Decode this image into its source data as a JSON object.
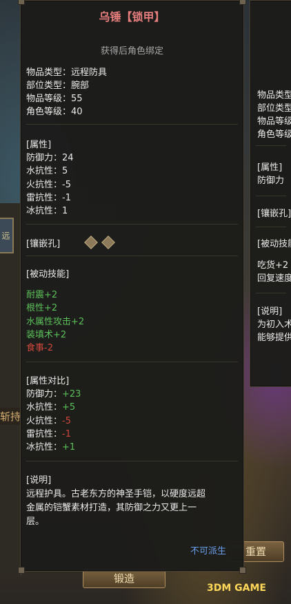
{
  "main": {
    "title": "乌锤【锁甲】",
    "bind_text": "获得后角色绑定",
    "basic": [
      {
        "label": "物品类型：",
        "value": "远程防具"
      },
      {
        "label": "部位类型：",
        "value": "腕部"
      },
      {
        "label": "物品等级：",
        "value": "55"
      },
      {
        "label": "角色等级：",
        "value": "40"
      }
    ],
    "attr_header": "[属性]",
    "attrs": [
      {
        "label": "防御力：",
        "value": "24"
      },
      {
        "label": "水抗性：",
        "value": "5"
      },
      {
        "label": "火抗性：",
        "value": "-5"
      },
      {
        "label": "雷抗性：",
        "value": "-1"
      },
      {
        "label": "冰抗性：",
        "value": "1"
      }
    ],
    "socket_header": "[镶嵌孔]",
    "skill_header": "[被动技能]",
    "skills": [
      {
        "text": "耐震+2",
        "color": "#5cc05a"
      },
      {
        "text": "根性+2",
        "color": "#5cc05a"
      },
      {
        "text": "水属性攻击+2",
        "color": "#5cc05a"
      },
      {
        "text": "装填术+2",
        "color": "#5cc05a"
      },
      {
        "text": "食事-2",
        "color": "#d0483c"
      }
    ],
    "compare_header": "[属性对比]",
    "compare": [
      {
        "label": "防御力：",
        "value": "+23",
        "color": "#5cc05a"
      },
      {
        "label": "水抗性：",
        "value": "+5",
        "color": "#5cc05a"
      },
      {
        "label": "火抗性：",
        "value": "-5",
        "color": "#d0483c"
      },
      {
        "label": "雷抗性：",
        "value": "-1",
        "color": "#d0483c"
      },
      {
        "label": "冰抗性：",
        "value": "+1",
        "color": "#5cc05a"
      }
    ],
    "desc_header": "[说明]",
    "desc_lines": [
      "远程护具。古老东方的神圣手铠，以硬度远超",
      "金属的铠蟹素材打造，其防御之力又更上一",
      "层。"
    ],
    "derive": "不可派生"
  },
  "side": {
    "basic": [
      "物品类型",
      "部位类型",
      "物品等级",
      "角色等级"
    ],
    "attr_header": "[属性]",
    "attr_line": "防御力",
    "socket_header": "[镶嵌孔]",
    "skill_header": "[被动技能]",
    "skills": [
      {
        "text": "吃货+2",
        "color": "#5cc05a"
      },
      {
        "text": "回复速度",
        "color": "#5cc05a"
      }
    ],
    "desc_header": "[说明]",
    "desc_lines": [
      "为初入术",
      "能够提供"
    ]
  },
  "background": {
    "left_icon": "远",
    "left_text": "斩持",
    "forge_button": "锻造",
    "reset_button": "重置",
    "watermark": "3DM GAME"
  }
}
